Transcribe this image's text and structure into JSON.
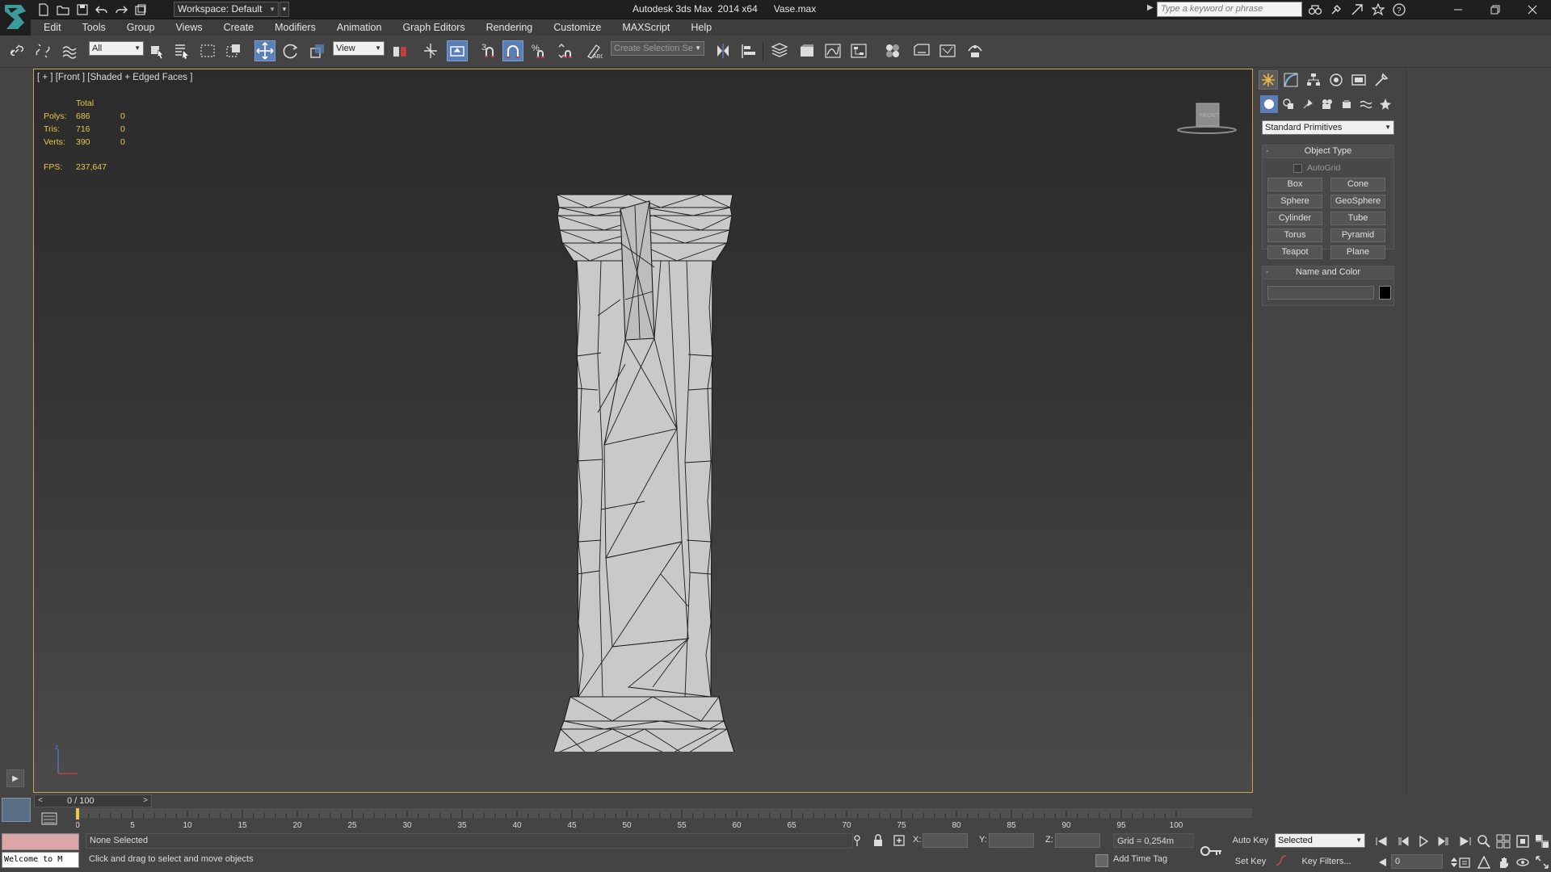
{
  "titlebar": {
    "workspace_label": "Workspace: Default",
    "title": "Autodesk 3ds Max  2014 x64      Vase.max",
    "search_placeholder": "Type a keyword or phrase"
  },
  "menu": [
    "Edit",
    "Tools",
    "Group",
    "Views",
    "Create",
    "Modifiers",
    "Animation",
    "Graph Editors",
    "Rendering",
    "Customize",
    "MAXScript",
    "Help"
  ],
  "toolbar": {
    "selection_filter": "All",
    "reference_coord": "View",
    "selection_set_placeholder": "Create Selection Se",
    "snap_label": "3"
  },
  "viewport": {
    "label": "[ + ] [Front ] [Shaded + Edged Faces ]",
    "stats_header": "Total",
    "stats": [
      {
        "label": "Polys:",
        "total": "686",
        "selected": "0"
      },
      {
        "label": "Tris:",
        "total": "716",
        "selected": "0"
      },
      {
        "label": "Verts:",
        "total": "390",
        "selected": "0"
      }
    ],
    "fps_label": "FPS:",
    "fps_value": "237,647",
    "viewcube_label": "FRONT"
  },
  "command_panel": {
    "category": "Standard Primitives",
    "object_type_title": "Object Type",
    "autogrid_label": "AutoGrid",
    "autogrid_checked": false,
    "primitives": [
      "Box",
      "Cone",
      "Sphere",
      "GeoSphere",
      "Cylinder",
      "Tube",
      "Torus",
      "Pyramid",
      "Teapot",
      "Plane"
    ],
    "name_color_title": "Name and Color",
    "object_name": "",
    "object_color": "#000000"
  },
  "timeline": {
    "frame_display": "0 / 100",
    "ticks": [
      "0",
      "5",
      "10",
      "15",
      "20",
      "25",
      "30",
      "35",
      "40",
      "45",
      "50",
      "55",
      "60",
      "65",
      "70",
      "75",
      "80",
      "85",
      "90",
      "95",
      "100"
    ]
  },
  "status": {
    "listener_text": "Welcome to M",
    "selection": "None Selected",
    "prompt": "Click and drag to select and move objects",
    "x_label": "X:",
    "y_label": "Y:",
    "z_label": "Z:",
    "grid": "Grid = 0,254m",
    "add_time_tag": "Add Time Tag",
    "auto_key": "Auto Key",
    "set_key": "Set Key",
    "key_mode": "Selected",
    "key_filters": "Key Filters...",
    "current_frame": "0"
  },
  "colors": {
    "viewport_border": "#c8a44a",
    "stats_text": "#e9c84a",
    "active_tool": "#5b7fb4"
  }
}
